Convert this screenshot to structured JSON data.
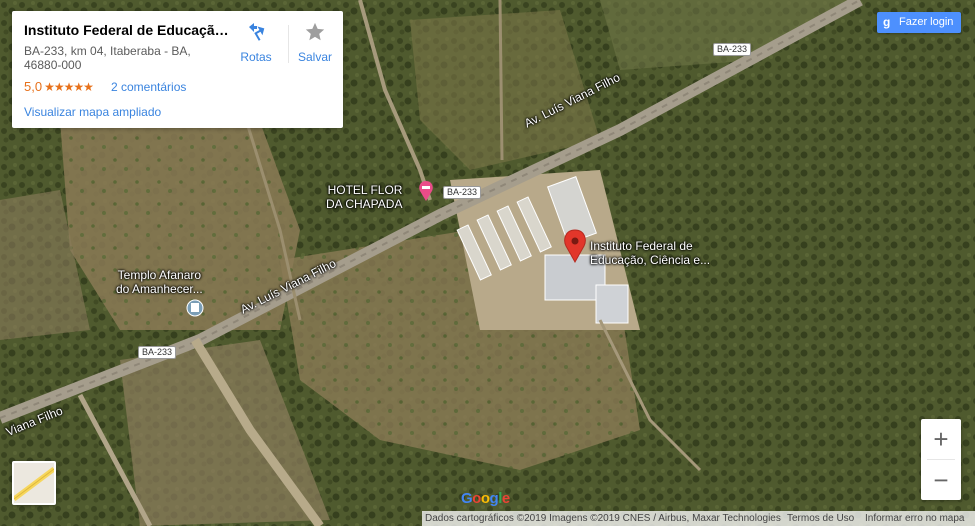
{
  "place": {
    "name": "Instituto Federal de Educação,...",
    "address": "BA-233, km 04, Itaberaba - BA, 46880-000",
    "rating": "5,0",
    "stars": "★★★★★",
    "reviews": "2 comentários",
    "view_larger": "Visualizar mapa ampliado"
  },
  "actions": {
    "directions": "Rotas",
    "save": "Salvar"
  },
  "login": {
    "g": "g",
    "label": "Fazer login"
  },
  "map_labels": {
    "pin_label_1": "Instituto Federal de",
    "pin_label_2": "Educação, Ciência e...",
    "hotel_1": "HOTEL FLOR",
    "hotel_2": "DA CHAPADA",
    "temple_1": "Templo Afanaro",
    "temple_2": "do Amanhecer...",
    "road_main": "Av. Luís Viana Filho",
    "road_short": "Viana Filho",
    "shield_1": "BA-233",
    "shield_2": "BA-233",
    "shield_3": "BA-233"
  },
  "zoom": {
    "in": "+",
    "out": "−"
  },
  "footer": {
    "data": "Dados cartográficos ©2019 Imagens ©2019 CNES / Airbus, Maxar Technologies",
    "terms": "Termos de Uso",
    "report": "Informar erro no mapa"
  },
  "google": {
    "G": "G",
    "o1": "o",
    "o2": "o",
    "g": "g",
    "l": "l",
    "e": "e"
  },
  "colors": {
    "link": "#3a84df",
    "rating": "#e7711b",
    "login": "#4d90fe",
    "pin": "#e2362a"
  },
  "icons": {
    "directions": "directions-icon",
    "save": "star-icon",
    "hotel": "bed-icon",
    "temple": "temple-icon",
    "pin": "map-pin-icon"
  }
}
